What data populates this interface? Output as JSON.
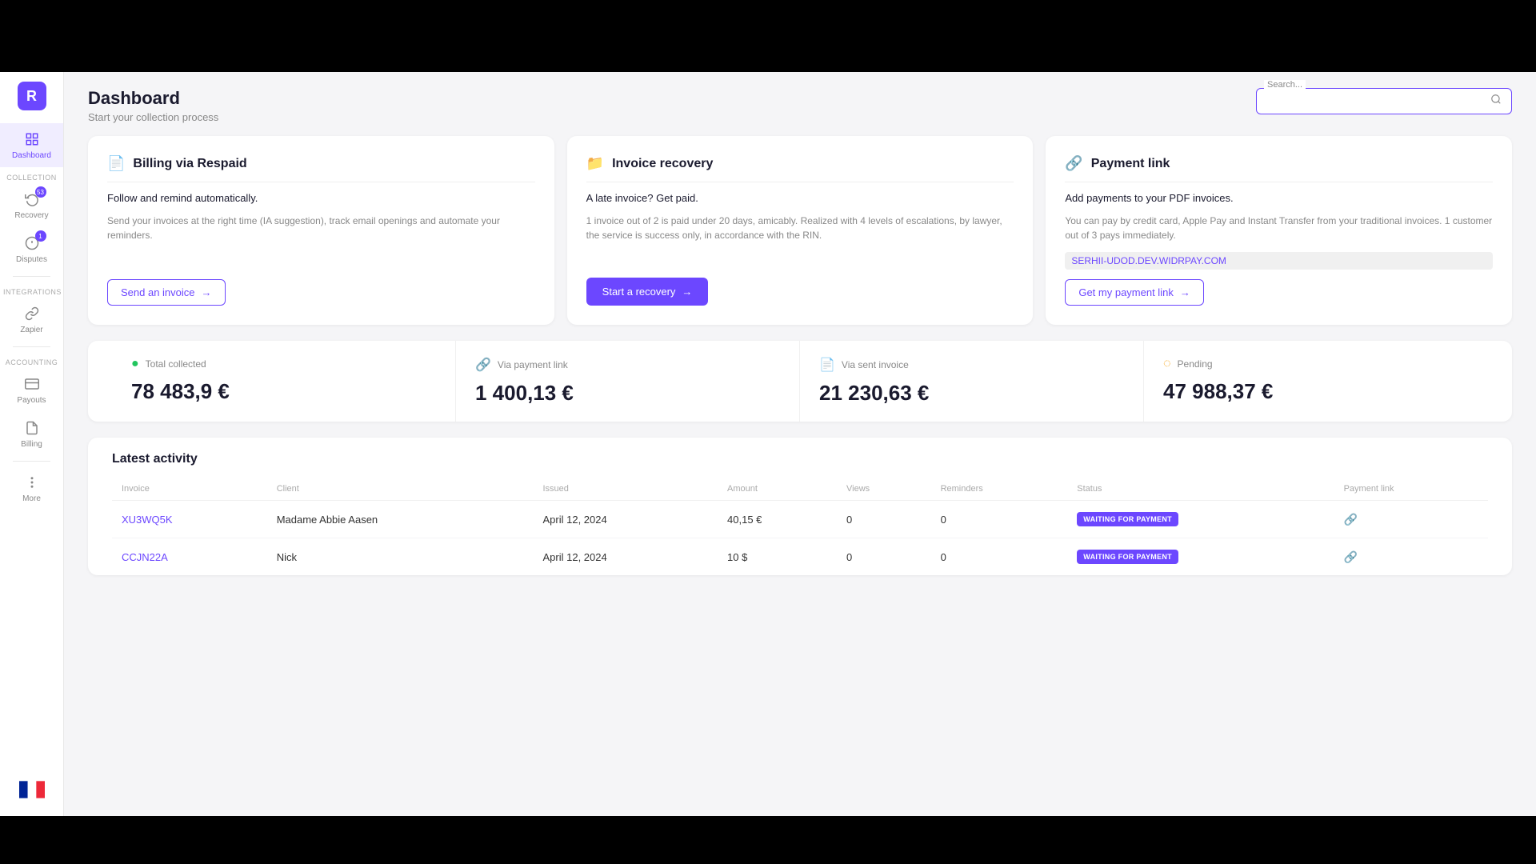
{
  "app": {
    "logo": "R"
  },
  "header": {
    "title": "Dashboard",
    "subtitle": "Start your collection process",
    "search_placeholder": "Search..."
  },
  "sidebar": {
    "logo": "R",
    "items": [
      {
        "id": "dashboard",
        "label": "Dashboard",
        "icon": "grid",
        "active": true
      },
      {
        "id": "recovery",
        "label": "Recovery",
        "icon": "refresh",
        "badge": "53",
        "active": false
      },
      {
        "id": "disputes",
        "label": "Disputes",
        "icon": "circle",
        "badge": "1",
        "active": false
      }
    ],
    "sections": [
      {
        "label": "COLLECTION"
      },
      {
        "label": "INTEGRATIONS"
      },
      {
        "label": "ACCOUNTING"
      }
    ],
    "integrations": [
      {
        "id": "zapier",
        "label": "Zapier",
        "icon": "link"
      }
    ],
    "accounting": [
      {
        "id": "payouts",
        "label": "Payouts",
        "icon": "wallet"
      },
      {
        "id": "billing",
        "label": "Billing",
        "icon": "receipt"
      }
    ],
    "more": {
      "label": "More",
      "icon": "dots"
    }
  },
  "cards": [
    {
      "id": "billing",
      "icon": "📄",
      "title": "Billing via Respaid",
      "main_text": "Follow and remind automatically.",
      "description": "Send your invoices at the right time (IA suggestion), track email openings and automate your reminders.",
      "button": "Send an invoice",
      "button_type": "outline"
    },
    {
      "id": "recovery",
      "icon": "📁",
      "title": "Invoice recovery",
      "main_text": "A late invoice? Get paid.",
      "description": "1 invoice out of 2 is paid under 20 days, amicably. Realized with 4 levels of escalations, by lawyer, the service is success only, in accordance with the RIN.",
      "button": "Start a recovery",
      "button_type": "solid"
    },
    {
      "id": "payment-link",
      "icon": "🔗",
      "title": "Payment link",
      "main_text": "Add payments to your PDF invoices.",
      "description": "You can pay by credit card, Apple Pay and Instant Transfer from your traditional invoices. 1 customer out of 3 pays immediately.",
      "link_text": "SERHII-UDOD.DEV.WIDRPAY.COM",
      "button": "Get my payment link",
      "button_type": "outline"
    }
  ],
  "stats": [
    {
      "id": "total-collected",
      "label": "Total collected",
      "icon_type": "green",
      "value": "78 483,9 €"
    },
    {
      "id": "via-payment-link",
      "label": "Via payment link",
      "icon_type": "purple",
      "value": "1 400,13 €"
    },
    {
      "id": "via-sent-invoice",
      "label": "Via sent invoice",
      "icon_type": "blue",
      "value": "21 230,63 €"
    },
    {
      "id": "pending",
      "label": "Pending",
      "icon_type": "yellow",
      "value": "47 988,37 €"
    }
  ],
  "activity": {
    "title": "Latest activity",
    "columns": [
      "Invoice",
      "Client",
      "Issued",
      "Amount",
      "Views",
      "Reminders",
      "Status",
      "Payment link"
    ],
    "rows": [
      {
        "invoice": "XU3WQ5K",
        "client": "Madame Abbie Aasen",
        "issued": "April 12, 2024",
        "amount": "40,15 €",
        "views": "0",
        "reminders": "0",
        "status": "WAITING FOR PAYMENT"
      },
      {
        "invoice": "CCJN22A",
        "client": "Nick",
        "issued": "April 12, 2024",
        "amount": "10 $",
        "views": "0",
        "reminders": "0",
        "status": "WAITING FOR PAYMENT"
      }
    ]
  }
}
